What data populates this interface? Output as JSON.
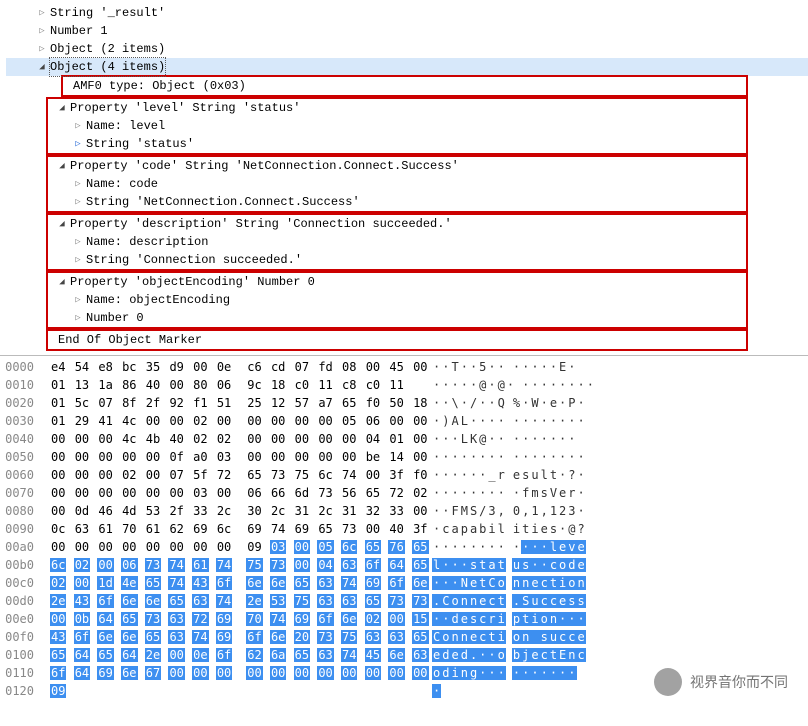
{
  "tree": {
    "r0": "String '_result'",
    "r1": "Number 1",
    "r2": "Object (2 items)",
    "r3": "Object (4 items)",
    "r4": "AMF0 type: Object (0x03)",
    "p1": "Property 'level' String 'status'",
    "p1n": "Name: level",
    "p1v": "String 'status'",
    "p2": "Property 'code' String 'NetConnection.Connect.Success'",
    "p2n": "Name: code",
    "p2v": "String 'NetConnection.Connect.Success'",
    "p3": "Property 'description' String 'Connection succeeded.'",
    "p3n": "Name: description",
    "p3v": "String 'Connection succeeded.'",
    "p4": "Property 'objectEncoding' Number 0",
    "p4n": "Name: objectEncoding",
    "p4v": "Number 0",
    "end": "End Of Object Marker"
  },
  "hex": [
    {
      "off": "0000",
      "b1": "e4 54 e8 bc 35 d9 00 0e",
      "b2": "c6 cd 07 fd 08 00 45 00",
      "a1": "··T··5··",
      "a2": "·····E·",
      "hl1": [],
      "hl2": [],
      "ha1": [],
      "ha2": []
    },
    {
      "off": "0010",
      "b1": "01 13 1a 86 40 00 80 06",
      "b2": "9c 18 c0 11 c8 c0 11",
      "a1": "·····@·@·",
      "a2": "········",
      "hl1": [],
      "hl2": [],
      "ha1": [],
      "ha2": []
    },
    {
      "off": "0020",
      "b1": "01 5c 07 8f 2f 92 f1 51",
      "b2": "25 12 57 a7 65 f0 50 18",
      "a1": "··\\·/··Q",
      "a2": "%·W·e·P·",
      "hl1": [],
      "hl2": [],
      "ha1": [],
      "ha2": []
    },
    {
      "off": "0030",
      "b1": "01 29 41 4c 00 00 02 00",
      "b2": "00 00 00 00 05 06 00 00",
      "a1": "·)AL····",
      "a2": "········",
      "hl1": [],
      "hl2": [],
      "ha1": [],
      "ha2": []
    },
    {
      "off": "0040",
      "b1": "00 00 00 4c 4b 40 02 02",
      "b2": "00 00 00 00 00 04 01 00",
      "a1": "···LK@··",
      "a2": "·······",
      "hl1": [],
      "hl2": [],
      "ha1": [],
      "ha2": []
    },
    {
      "off": "0050",
      "b1": "00 00 00 00 00 0f a0 03",
      "b2": "00 00 00 00 00 be 14 00",
      "a1": "········",
      "a2": "········",
      "hl1": [],
      "hl2": [],
      "ha1": [],
      "ha2": []
    },
    {
      "off": "0060",
      "b1": "00 00 00 02 00 07 5f 72",
      "b2": "65 73 75 6c 74 00 3f f0",
      "a1": "······_r",
      "a2": "esult·?·",
      "hl1": [],
      "hl2": [],
      "ha1": [],
      "ha2": []
    },
    {
      "off": "0070",
      "b1": "00 00 00 00 00 00 03 00",
      "b2": "06 66 6d 73 56 65 72 02",
      "a1": "········",
      "a2": "·fmsVer·",
      "hl1": [],
      "hl2": [],
      "ha1": [],
      "ha2": []
    },
    {
      "off": "0080",
      "b1": "00 0d 46 4d 53 2f 33 2c",
      "b2": "30 2c 31 2c 31 32 33 00",
      "a1": "··FMS/3,",
      "a2": "0,1,123·",
      "hl1": [],
      "hl2": [],
      "ha1": [],
      "ha2": []
    },
    {
      "off": "0090",
      "b1": "0c 63 61 70 61 62 69 6c",
      "b2": "69 74 69 65 73 00 40 3f",
      "a1": "·capabil",
      "a2": "ities·@?",
      "hl1": [],
      "hl2": [],
      "ha1": [],
      "ha2": []
    },
    {
      "off": "00a0",
      "b1": "00 00 00 00 00 00 00 00",
      "b2": "09 03 00 05 6c 65 76 65",
      "a1": "········",
      "a2": "····leve",
      "hl1": [],
      "hl2": [
        1,
        2,
        3,
        4,
        5,
        6,
        7
      ],
      "ha1": [],
      "ha2": [
        1,
        2,
        3,
        4,
        5,
        6,
        7
      ]
    },
    {
      "off": "00b0",
      "b1": "6c 02 00 06 73 74 61 74",
      "b2": "75 73 00 04 63 6f 64 65",
      "a1": "l···stat",
      "a2": "us··code",
      "hl1": [
        0,
        1,
        2,
        3,
        4,
        5,
        6,
        7
      ],
      "hl2": [
        0,
        1,
        2,
        3,
        4,
        5,
        6,
        7
      ],
      "ha1": [
        0,
        1,
        2,
        3,
        4,
        5,
        6,
        7
      ],
      "ha2": [
        0,
        1,
        2,
        3,
        4,
        5,
        6,
        7
      ]
    },
    {
      "off": "00c0",
      "b1": "02 00 1d 4e 65 74 43 6f",
      "b2": "6e 6e 65 63 74 69 6f 6e",
      "a1": "···NetCo",
      "a2": "nnection",
      "hl1": [
        0,
        1,
        2,
        3,
        4,
        5,
        6,
        7
      ],
      "hl2": [
        0,
        1,
        2,
        3,
        4,
        5,
        6,
        7
      ],
      "ha1": [
        0,
        1,
        2,
        3,
        4,
        5,
        6,
        7
      ],
      "ha2": [
        0,
        1,
        2,
        3,
        4,
        5,
        6,
        7
      ]
    },
    {
      "off": "00d0",
      "b1": "2e 43 6f 6e 6e 65 63 74",
      "b2": "2e 53 75 63 63 65 73 73",
      "a1": ".Connect",
      "a2": ".Success",
      "hl1": [
        0,
        1,
        2,
        3,
        4,
        5,
        6,
        7
      ],
      "hl2": [
        0,
        1,
        2,
        3,
        4,
        5,
        6,
        7
      ],
      "ha1": [
        0,
        1,
        2,
        3,
        4,
        5,
        6,
        7
      ],
      "ha2": [
        0,
        1,
        2,
        3,
        4,
        5,
        6,
        7
      ]
    },
    {
      "off": "00e0",
      "b1": "00 0b 64 65 73 63 72 69",
      "b2": "70 74 69 6f 6e 02 00 15",
      "a1": "··descri",
      "a2": "ption···",
      "hl1": [
        0,
        1,
        2,
        3,
        4,
        5,
        6,
        7
      ],
      "hl2": [
        0,
        1,
        2,
        3,
        4,
        5,
        6,
        7
      ],
      "ha1": [
        0,
        1,
        2,
        3,
        4,
        5,
        6,
        7
      ],
      "ha2": [
        0,
        1,
        2,
        3,
        4,
        5,
        6,
        7
      ]
    },
    {
      "off": "00f0",
      "b1": "43 6f 6e 6e 65 63 74 69",
      "b2": "6f 6e 20 73 75 63 63 65",
      "a1": "Connecti",
      "a2": "on succe",
      "hl1": [
        0,
        1,
        2,
        3,
        4,
        5,
        6,
        7
      ],
      "hl2": [
        0,
        1,
        2,
        3,
        4,
        5,
        6,
        7
      ],
      "ha1": [
        0,
        1,
        2,
        3,
        4,
        5,
        6,
        7
      ],
      "ha2": [
        0,
        1,
        2,
        3,
        4,
        5,
        6,
        7
      ]
    },
    {
      "off": "0100",
      "b1": "65 64 65 64 2e 00 0e 6f",
      "b2": "62 6a 65 63 74 45 6e 63",
      "a1": "eded.··o",
      "a2": "bjectEnc",
      "hl1": [
        0,
        1,
        2,
        3,
        4,
        5,
        6,
        7
      ],
      "hl2": [
        0,
        1,
        2,
        3,
        4,
        5,
        6,
        7
      ],
      "ha1": [
        0,
        1,
        2,
        3,
        4,
        5,
        6,
        7
      ],
      "ha2": [
        0,
        1,
        2,
        3,
        4,
        5,
        6,
        7
      ]
    },
    {
      "off": "0110",
      "b1": "6f 64 69 6e 67 00 00 00",
      "b2": "00 00 00 00 00 00 00 00",
      "a1": "oding···",
      "a2": "·······",
      "hl1": [
        0,
        1,
        2,
        3,
        4,
        5,
        6,
        7
      ],
      "hl2": [
        0,
        1,
        2,
        3,
        4,
        5,
        6,
        7
      ],
      "ha1": [
        0,
        1,
        2,
        3,
        4,
        5,
        6,
        7
      ],
      "ha2": [
        0,
        1,
        2,
        3,
        4,
        5,
        6,
        7
      ]
    },
    {
      "off": "0120",
      "b1": "09",
      "b2": "",
      "a1": "·",
      "a2": "",
      "hl1": [
        0
      ],
      "hl2": [],
      "ha1": [
        0
      ],
      "ha2": []
    }
  ],
  "watermark": "视界音你而不同"
}
